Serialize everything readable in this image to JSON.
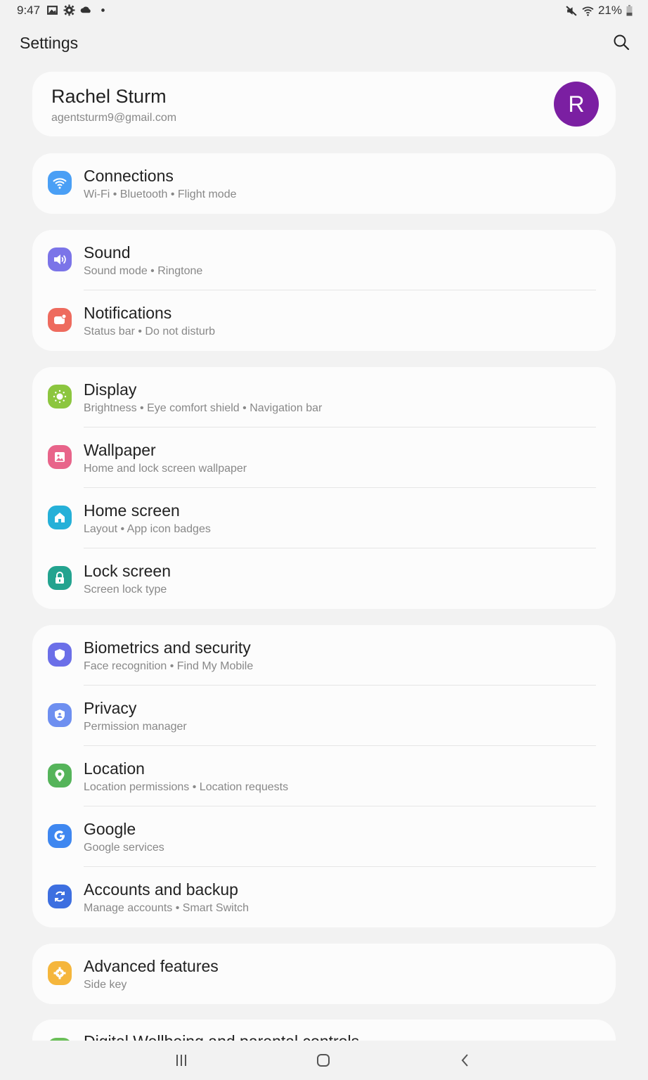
{
  "status_bar": {
    "time": "9:47",
    "left_icons": [
      "gallery-icon",
      "gear-icon",
      "cloud-icon",
      "dot-icon"
    ],
    "right_icons": [
      "mute-icon",
      "wifi-icon"
    ],
    "battery": "21%"
  },
  "header": {
    "title": "Settings",
    "search_icon": "search-icon"
  },
  "profile": {
    "name": "Rachel Sturm",
    "email": "agentsturm9@gmail.com",
    "avatar_letter": "R",
    "avatar_color": "#7b1fa2"
  },
  "groups": [
    {
      "items": [
        {
          "title": "Connections",
          "subtitle": "Wi-Fi  •  Bluetooth  •  Flight mode",
          "icon": "wifi-icon",
          "color": "#4a9ff5"
        }
      ]
    },
    {
      "items": [
        {
          "title": "Sound",
          "subtitle": "Sound mode  •  Ringtone",
          "icon": "volume-icon",
          "color": "#7b74e8"
        },
        {
          "title": "Notifications",
          "subtitle": "Status bar  •  Do not disturb",
          "icon": "notification-icon",
          "color": "#ee6b5e"
        }
      ]
    },
    {
      "items": [
        {
          "title": "Display",
          "subtitle": "Brightness  •  Eye comfort shield  •  Navigation bar",
          "icon": "sun-icon",
          "color": "#8cc63f"
        },
        {
          "title": "Wallpaper",
          "subtitle": "Home and lock screen wallpaper",
          "icon": "image-icon",
          "color": "#e8648a"
        },
        {
          "title": "Home screen",
          "subtitle": "Layout  •  App icon badges",
          "icon": "home-icon",
          "color": "#25b0d8"
        },
        {
          "title": "Lock screen",
          "subtitle": "Screen lock type",
          "icon": "lock-icon",
          "color": "#23a38f"
        }
      ]
    },
    {
      "items": [
        {
          "title": "Biometrics and security",
          "subtitle": "Face recognition  •  Find My Mobile",
          "icon": "shield-icon",
          "color": "#6b6fe8"
        },
        {
          "title": "Privacy",
          "subtitle": "Permission manager",
          "icon": "privacy-shield-icon",
          "color": "#6e8ff0"
        },
        {
          "title": "Location",
          "subtitle": "Location permissions  •  Location requests",
          "icon": "location-pin-icon",
          "color": "#55b45a"
        },
        {
          "title": "Google",
          "subtitle": "Google services",
          "icon": "google-icon",
          "color": "#3f87f0"
        },
        {
          "title": "Accounts and backup",
          "subtitle": "Manage accounts  •  Smart Switch",
          "icon": "sync-icon",
          "color": "#3d6fe0"
        }
      ]
    },
    {
      "items": [
        {
          "title": "Advanced features",
          "subtitle": "Side key",
          "icon": "gear-plus-icon",
          "color": "#f5b63c"
        }
      ]
    }
  ],
  "peek_item": {
    "title": "Digital Wellbeing and parental controls"
  },
  "nav_bar": {
    "recents": "recents-icon",
    "home": "home-button-icon",
    "back": "back-icon"
  }
}
